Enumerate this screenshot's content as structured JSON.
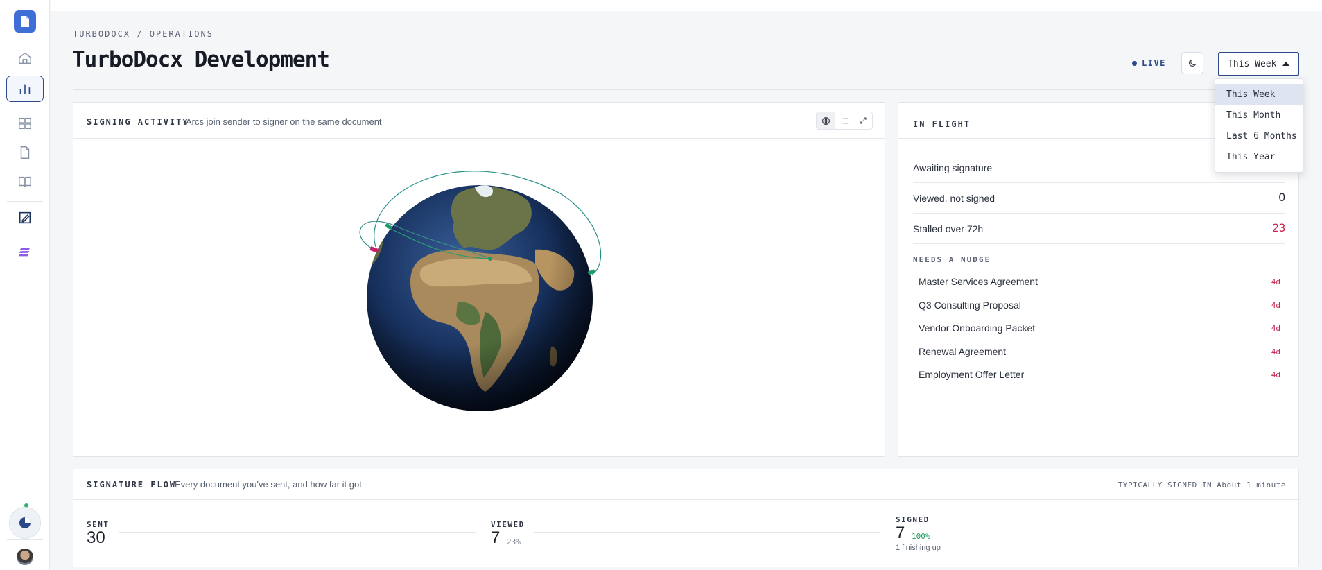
{
  "breadcrumb": "TURBODOCX / OPERATIONS",
  "page_title": "TurboDocx Development",
  "live_label": "LIVE",
  "range_select": {
    "value": "This Week",
    "options": [
      "This Week",
      "This Month",
      "Last 6 Months",
      "This Year"
    ]
  },
  "signing_activity": {
    "label": "SIGNING ACTIVITY",
    "subtitle": "Arcs join sender to signer on the same document"
  },
  "in_flight": {
    "label": "IN FLIGHT",
    "rows": [
      {
        "label": "Awaiting signature",
        "value": ""
      },
      {
        "label": "Viewed, not signed",
        "value": "0"
      },
      {
        "label": "Stalled over 72h",
        "value": "23"
      }
    ],
    "nudge_title": "NEEDS A NUDGE",
    "nudges": [
      {
        "name": "Master Services Agreement",
        "age": "4d"
      },
      {
        "name": "Q3 Consulting Proposal",
        "age": "4d"
      },
      {
        "name": "Vendor Onboarding Packet",
        "age": "4d"
      },
      {
        "name": "Renewal Agreement",
        "age": "4d"
      },
      {
        "name": "Employment Offer Letter",
        "age": "4d"
      }
    ]
  },
  "signature_flow": {
    "label": "SIGNATURE FLOW",
    "subtitle": "Every document you've sent, and how far it got",
    "typical_label": "TYPICALLY SIGNED IN",
    "typical_value": "About 1 minute",
    "sent": {
      "label": "SENT",
      "value": "30"
    },
    "viewed": {
      "label": "VIEWED",
      "value": "7",
      "pct": "23%"
    },
    "signed": {
      "label": "SIGNED",
      "value": "7",
      "pct": "100%",
      "note": "1 finishing up"
    }
  },
  "colors": {
    "accent": "#2c4a8a",
    "danger": "#c4234f",
    "success": "#1f9a62",
    "logo": "#3e6fd6"
  }
}
